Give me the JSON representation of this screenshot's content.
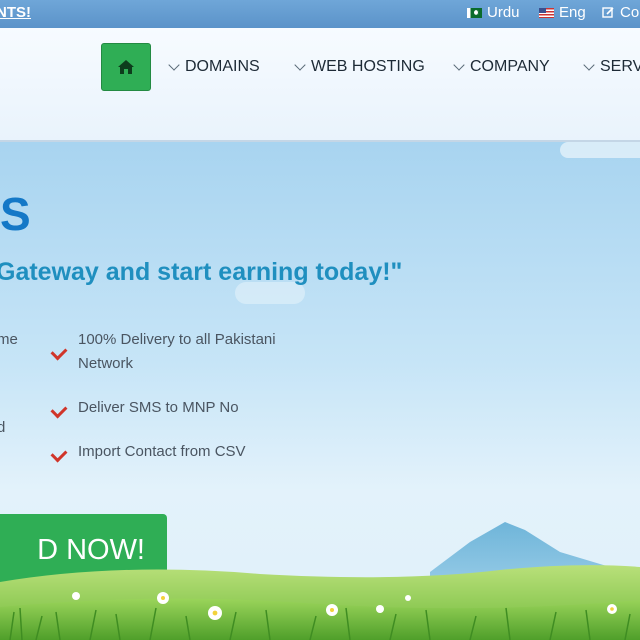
{
  "topbar": {
    "promo": "NTS!",
    "languages": [
      {
        "label": "Urdu",
        "icon": "pakistan-flag-icon"
      },
      {
        "label": "Eng",
        "icon": "us-flag-icon"
      }
    ],
    "contact_label": "Co",
    "contact_icon": "edit-icon"
  },
  "nav": {
    "home_icon": "home-icon",
    "items": [
      {
        "label": "DOMAINS"
      },
      {
        "label": "WEB HOSTING"
      },
      {
        "label": "COMPANY"
      },
      {
        "label": "SERVI"
      }
    ]
  },
  "hero": {
    "heading": "S",
    "tagline": "Gateway and start earning today!\"",
    "left_fragments": [
      "me",
      "d"
    ],
    "features": [
      {
        "line1": "100% Delivery to all Pakistani",
        "line2": "Network"
      },
      {
        "line1": "Deliver SMS to MNP No"
      },
      {
        "line1": "Import Contact from CSV"
      }
    ],
    "cta": "D NOW!"
  },
  "colors": {
    "accent_green": "#2fae55",
    "heading_blue": "#1478c7",
    "tagline_blue": "#1f8fbf",
    "check_red": "#d0352a"
  }
}
